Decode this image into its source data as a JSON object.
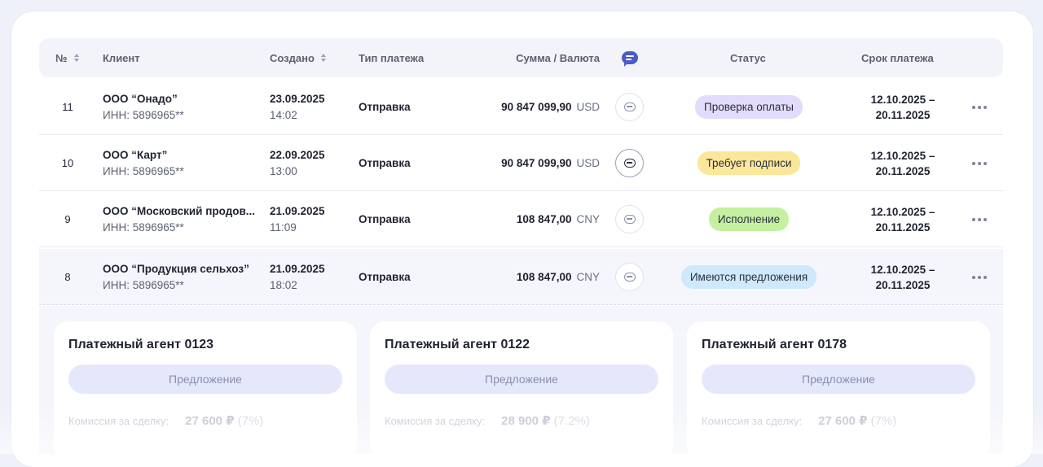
{
  "table": {
    "headers": {
      "num": "№",
      "client": "Клиент",
      "created": "Создано",
      "payment_type": "Тип платежа",
      "amount": "Сумма / Валюта",
      "comments_icon": "chat-icon",
      "status": "Статус",
      "due": "Срок платежа"
    },
    "rows": [
      {
        "num": "11",
        "client": "ООО “Онадо”",
        "inn": "ИНН: 5896965**",
        "date": "23.09.2025",
        "time": "14:02",
        "type": "Отправка",
        "amount": "90 847 099,90",
        "currency": "USD",
        "status": "Проверка оплаты",
        "status_color": "#e3dbfb",
        "due_from": "12.10.2025 –",
        "due_to": "20.11.2025"
      },
      {
        "num": "10",
        "client": "ООО “Карт”",
        "inn": "ИНН: 5896965**",
        "date": "22.09.2025",
        "time": "13:00",
        "type": "Отправка",
        "amount": "90 847 099,90",
        "currency": "USD",
        "status": "Требует подписи",
        "status_color": "#fbe79a",
        "due_from": "12.10.2025 –",
        "due_to": "20.11.2025"
      },
      {
        "num": "9",
        "client": "ООО “Московский продов...",
        "inn": "ИНН: 5896965**",
        "date": "21.09.2025",
        "time": "11:09",
        "type": "Отправка",
        "amount": "108 847,00",
        "currency": "CNY",
        "status": "Исполнение",
        "status_color": "#c4f0a0",
        "due_from": "12.10.2025 –",
        "due_to": "20.11.2025"
      },
      {
        "num": "8",
        "client": "ООО “Продукция сельхоз”",
        "inn": "ИНН: 5896965**",
        "date": "21.09.2025",
        "time": "18:02",
        "type": "Отправка",
        "amount": "108 847,00",
        "currency": "CNY",
        "status": "Имеются предложения",
        "status_color": "#cde9fb",
        "due_from": "12.10.2025 –",
        "due_to": "20.11.2025"
      }
    ]
  },
  "agents": [
    {
      "title": "Платежный агент 0123",
      "offer": "Предложение",
      "fee_label": "Комиссия за сделку:",
      "fee_value": "27 600 ₽",
      "fee_pct": "(7%)"
    },
    {
      "title": "Платежный агент 0122",
      "offer": "Предложение",
      "fee_label": "Комиссия за сделку:",
      "fee_value": "28 900 ₽",
      "fee_pct": "(7.2%)"
    },
    {
      "title": "Платежный агент 0178",
      "offer": "Предложение",
      "fee_label": "Комиссия за сделку:",
      "fee_value": "27 600 ₽",
      "fee_pct": "(7%)"
    }
  ]
}
